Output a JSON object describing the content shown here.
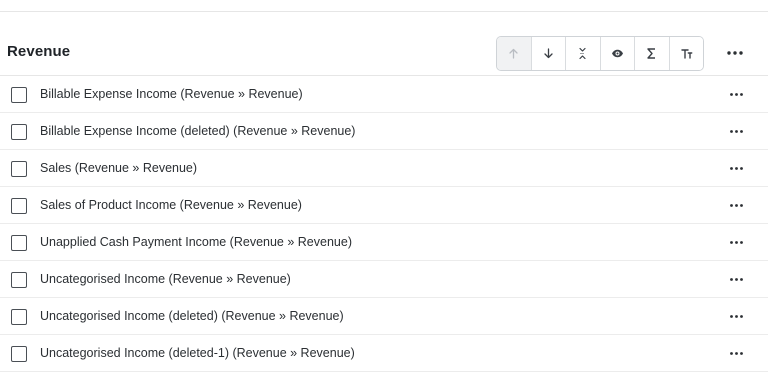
{
  "section": {
    "title": "Revenue"
  },
  "toolbar": {
    "buttons": [
      {
        "name": "sort-ascending",
        "icon": "arrow-up-icon",
        "disabled": true
      },
      {
        "name": "sort-descending",
        "icon": "arrow-down-icon",
        "disabled": false
      },
      {
        "name": "collapse",
        "icon": "collapse-icon",
        "disabled": false
      },
      {
        "name": "visibility",
        "icon": "eye-icon",
        "disabled": false
      },
      {
        "name": "summation",
        "icon": "sigma-icon",
        "disabled": false
      },
      {
        "name": "text-size",
        "icon": "text-size-icon",
        "disabled": false
      }
    ]
  },
  "header_more": {
    "icon": "more-horizontal-icon"
  },
  "rows": [
    {
      "label": "Billable Expense Income (Revenue » Revenue)"
    },
    {
      "label": "Billable Expense Income (deleted) (Revenue » Revenue)"
    },
    {
      "label": "Sales (Revenue » Revenue)"
    },
    {
      "label": "Sales of Product Income (Revenue » Revenue)"
    },
    {
      "label": "Unapplied Cash Payment Income (Revenue » Revenue)"
    },
    {
      "label": "Uncategorised Income (Revenue » Revenue)"
    },
    {
      "label": "Uncategorised Income (deleted) (Revenue » Revenue)"
    },
    {
      "label": "Uncategorised Income (deleted-1) (Revenue » Revenue)"
    }
  ],
  "colors": {
    "border": "#e6e6e6",
    "disabled_button_bg": "#f1f2f3",
    "text": "#2b2f33"
  }
}
